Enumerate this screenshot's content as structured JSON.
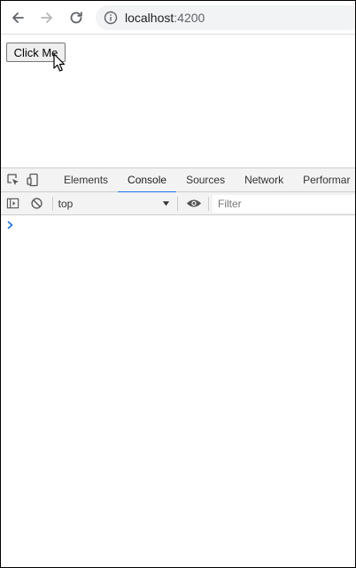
{
  "browser": {
    "url_host": "localhost",
    "url_port": ":4200"
  },
  "page": {
    "button_label": "Click Me"
  },
  "devtools": {
    "tabs": [
      {
        "label": "Elements"
      },
      {
        "label": "Console"
      },
      {
        "label": "Sources"
      },
      {
        "label": "Network"
      },
      {
        "label": "Performar"
      }
    ],
    "active_tab": "Console",
    "context": "top",
    "filter_placeholder": "Filter",
    "accent": "#1a73e8"
  }
}
